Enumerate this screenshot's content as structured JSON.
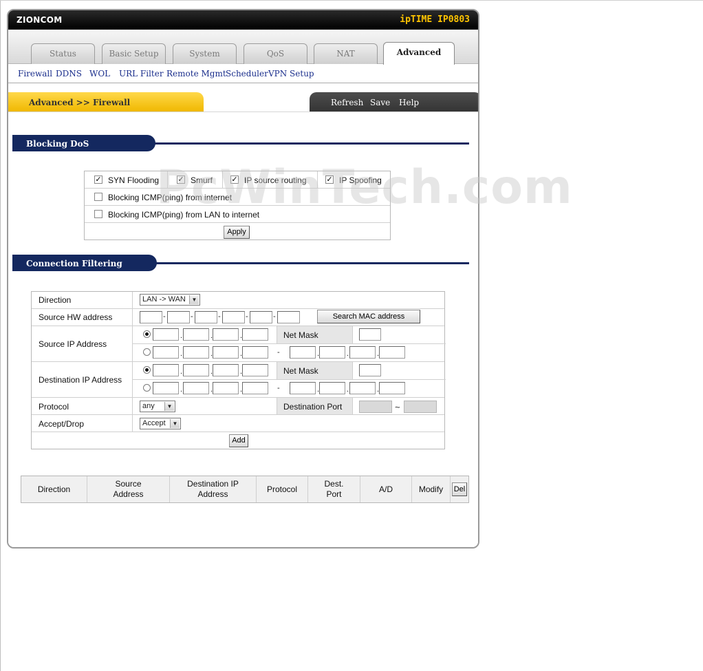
{
  "header": {
    "brand_left": "ZIONCOM",
    "brand_right": "ipTIME IP0803"
  },
  "tabs": [
    "Status",
    "Basic Setup",
    "System",
    "QoS",
    "NAT",
    "Advanced"
  ],
  "active_tab": "Advanced",
  "subnav": [
    "Firewall",
    "DDNS",
    "WOL",
    "URL Filter",
    "Remote Mgmt",
    "Scheduler",
    "VPN Setup"
  ],
  "breadcrumb": "Advanced >> Firewall",
  "actions": {
    "refresh": "Refresh",
    "save": "Save",
    "help": "Help"
  },
  "watermark": "PcWinTech.com",
  "blocking_dos": {
    "title": "Blocking DoS",
    "options": [
      {
        "label": "SYN Flooding",
        "checked": true
      },
      {
        "label": "Smurf",
        "checked": true
      },
      {
        "label": "IP source routing",
        "checked": true
      },
      {
        "label": "IP Spoofing",
        "checked": true
      }
    ],
    "icmp_internet": {
      "label": "Blocking ICMP(ping) from internet",
      "checked": false
    },
    "icmp_lan": {
      "label": "Blocking ICMP(ping) from LAN to internet",
      "checked": false
    },
    "apply_label": "Apply"
  },
  "connection_filtering": {
    "title": "Connection Filtering",
    "direction_label": "Direction",
    "direction_value": "LAN -> WAN",
    "source_hw_label": "Source HW address",
    "search_mac_label": "Search MAC address",
    "source_ip_label": "Source IP Address",
    "dest_ip_label": "Destination IP Address",
    "net_mask_label": "Net Mask",
    "range_dash": "-",
    "protocol_label": "Protocol",
    "protocol_value": "any",
    "dest_port_label": "Destination Port",
    "port_tilde": "~",
    "accept_drop_label": "Accept/Drop",
    "accept_drop_value": "Accept",
    "add_label": "Add",
    "mac_sep": "-",
    "ip_sep": "."
  },
  "rule_table": {
    "columns": [
      "Direction",
      "Source Address",
      "Destination IP Address",
      "Protocol",
      "Dest. Port",
      "A/D",
      "Modify"
    ],
    "col_display": [
      "Direction",
      "Source\nAddress",
      "Destination IP\nAddress",
      "Protocol",
      "Dest.\nPort",
      "A/D",
      "Modify"
    ],
    "del_label": "Del"
  }
}
